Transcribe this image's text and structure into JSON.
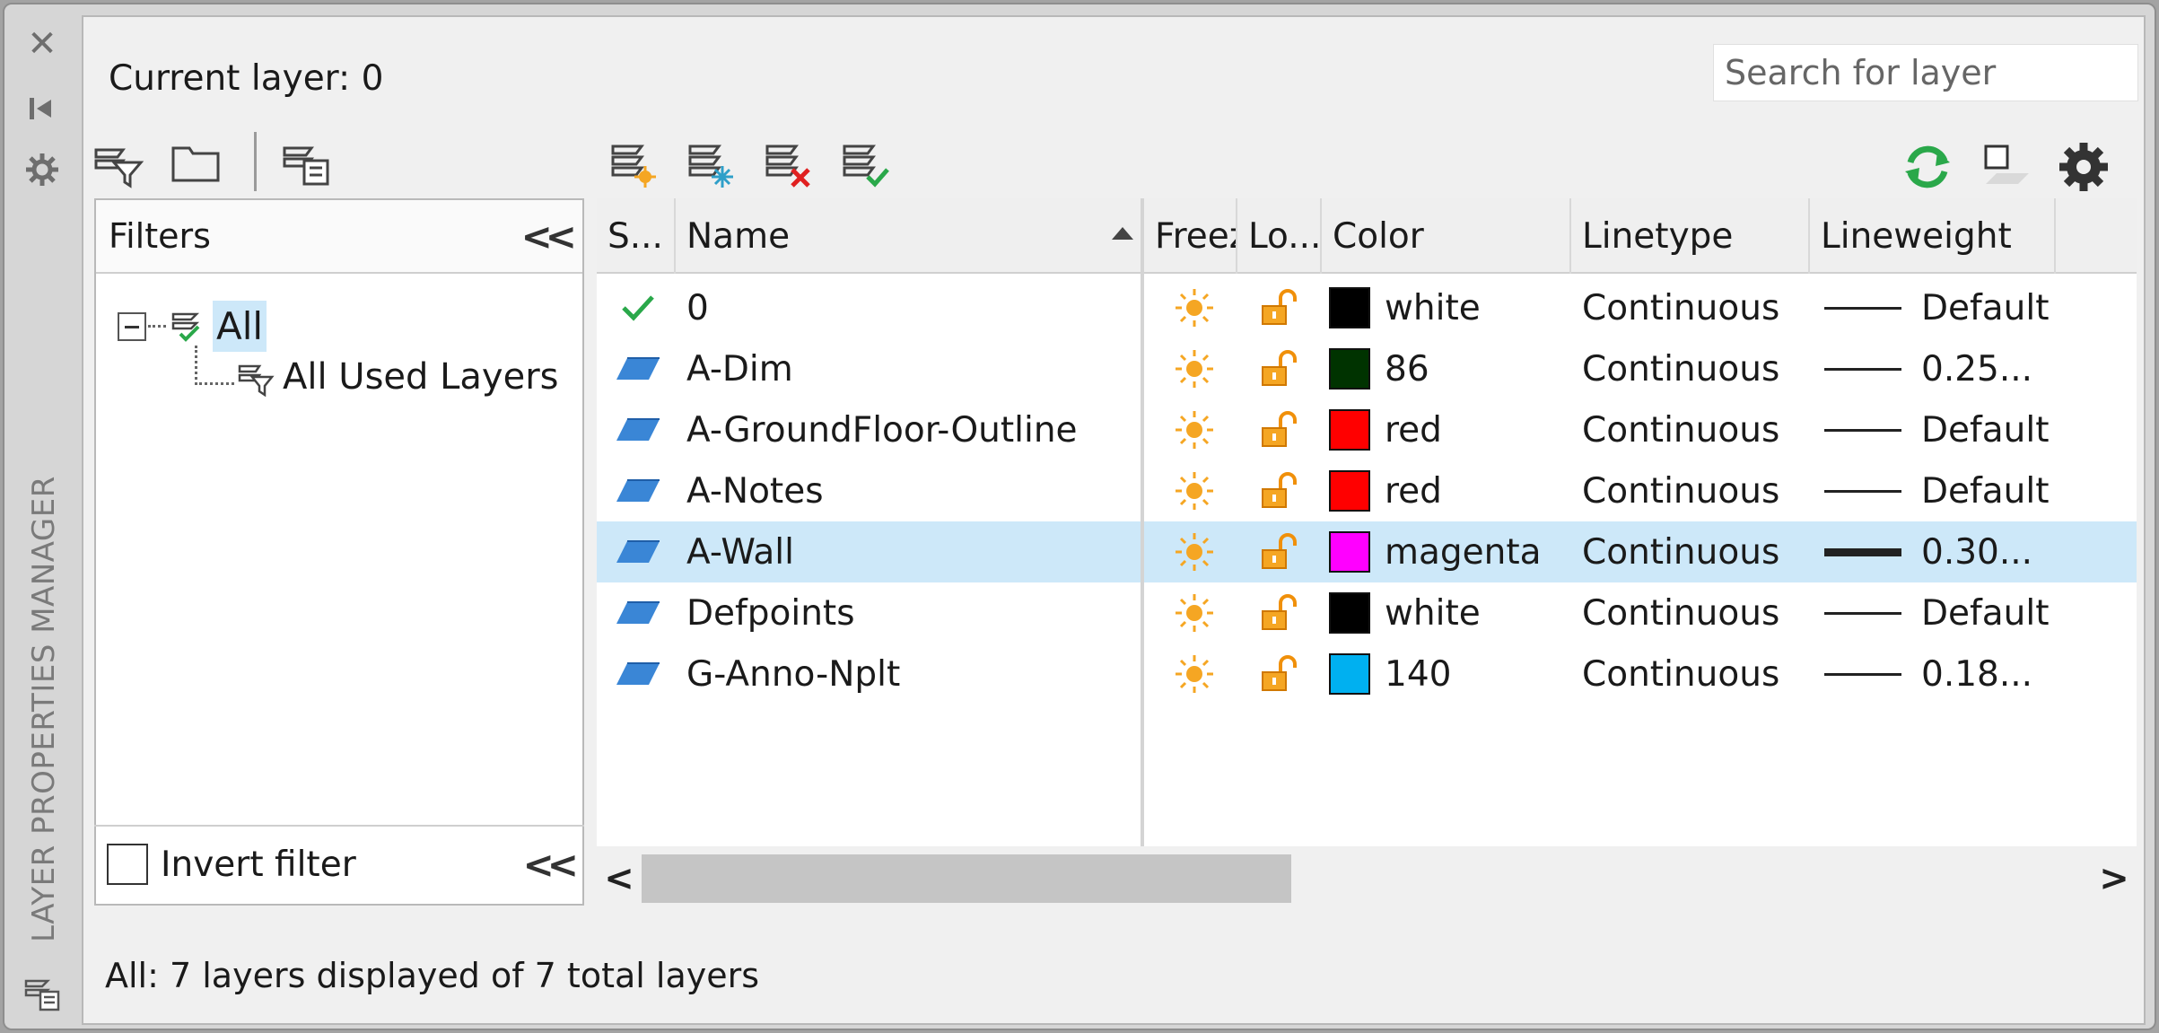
{
  "title_bar": {
    "title": "LAYER PROPERTIES MANAGER"
  },
  "header": {
    "current_layer_label": "Current layer: 0",
    "search_placeholder": "Search for layer"
  },
  "filters": {
    "header_label": "Filters",
    "tree": {
      "root": "All",
      "children": [
        "All Used Layers"
      ]
    },
    "invert_label": "Invert filter",
    "invert_checked": false
  },
  "columns": [
    "S...",
    "Name",
    "Freeze",
    "Lo...",
    "Color",
    "Linetype",
    "Lineweight"
  ],
  "layers": [
    {
      "status": "current",
      "name": "0",
      "freeze": "sun",
      "lock": "unlocked",
      "color_name": "white",
      "swatch": "#000000",
      "linetype": "Continuous",
      "lineweight": "Default",
      "thick": false
    },
    {
      "status": "layer",
      "name": "A-Dim",
      "freeze": "sun",
      "lock": "unlocked",
      "color_name": "86",
      "swatch": "#003300",
      "linetype": "Continuous",
      "lineweight": "0.25...",
      "thick": false
    },
    {
      "status": "layer",
      "name": "A-GroundFloor-Outline",
      "freeze": "sun",
      "lock": "unlocked",
      "color_name": "red",
      "swatch": "#ff0000",
      "linetype": "Continuous",
      "lineweight": "Default",
      "thick": false
    },
    {
      "status": "layer",
      "name": "A-Notes",
      "freeze": "sun",
      "lock": "unlocked",
      "color_name": "red",
      "swatch": "#ff0000",
      "linetype": "Continuous",
      "lineweight": "Default",
      "thick": false
    },
    {
      "status": "layer",
      "name": "A-Wall",
      "freeze": "sun",
      "lock": "unlocked",
      "color_name": "magenta",
      "swatch": "#ff00ff",
      "linetype": "Continuous",
      "lineweight": "0.30...",
      "thick": true,
      "selected": true
    },
    {
      "status": "layer",
      "name": "Defpoints",
      "freeze": "sun",
      "lock": "unlocked",
      "color_name": "white",
      "swatch": "#000000",
      "linetype": "Continuous",
      "lineweight": "Default",
      "thick": false
    },
    {
      "status": "layer",
      "name": "G-Anno-Nplt",
      "freeze": "sun",
      "lock": "unlocked",
      "color_name": "140",
      "swatch": "#00b0f0",
      "linetype": "Continuous",
      "lineweight": "0.18...",
      "thick": false
    }
  ],
  "status_bar": {
    "text": "All: 7 layers displayed of 7 total layers"
  },
  "colors": {
    "selection": "#cde8f9",
    "accent_green": "#2aa84a",
    "sun_orange": "#f5a623",
    "layer_blue": "#3a86d6"
  }
}
